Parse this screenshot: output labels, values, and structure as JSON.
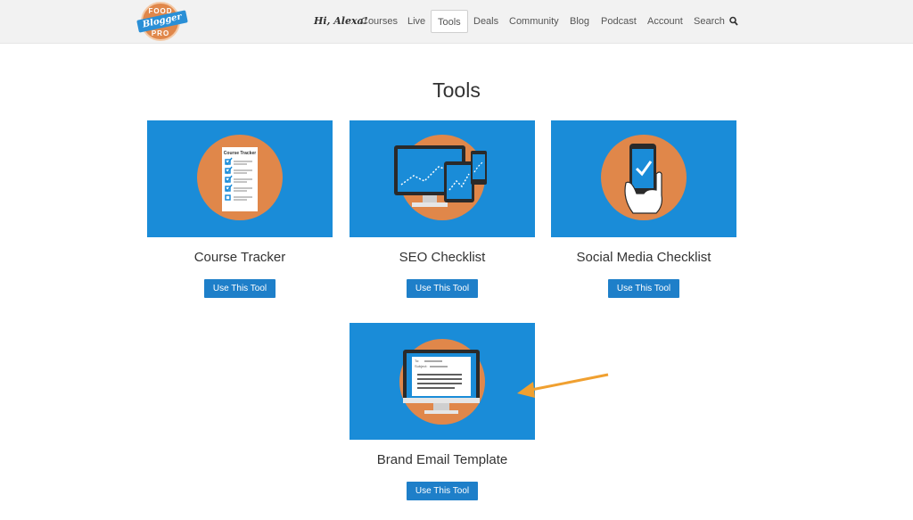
{
  "logo": {
    "top": "FOOD",
    "ribbon": "Blogger",
    "bottom": "PRO"
  },
  "nav": {
    "greeting": "Hi, Alexa!",
    "items": [
      {
        "label": "Courses"
      },
      {
        "label": "Live"
      },
      {
        "label": "Tools"
      },
      {
        "label": "Deals"
      },
      {
        "label": "Community"
      },
      {
        "label": "Blog"
      },
      {
        "label": "Podcast"
      },
      {
        "label": "Account"
      },
      {
        "label": "Search"
      }
    ],
    "active": "Tools"
  },
  "page": {
    "title": "Tools"
  },
  "tools": [
    {
      "title": "Course Tracker",
      "button": "Use This Tool",
      "image_label": "Course Tracker"
    },
    {
      "title": "SEO Checklist",
      "button": "Use This Tool"
    },
    {
      "title": "Social Media Checklist",
      "button": "Use This Tool"
    },
    {
      "title": "Brand Email Template",
      "button": "Use This Tool",
      "image_labels": {
        "to": "To:",
        "subject": "Subject:"
      }
    }
  ],
  "colors": {
    "card_bg": "#1a8cd8",
    "circle": "#e0874a",
    "button": "#1e7fc9",
    "arrow": "#f0a030"
  }
}
